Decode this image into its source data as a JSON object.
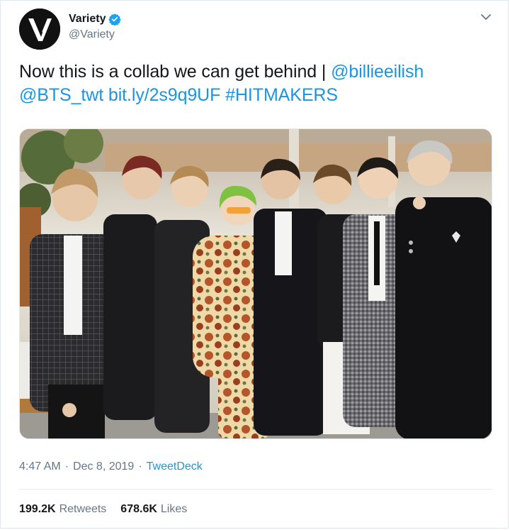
{
  "author": {
    "display_name": "Variety",
    "handle": "@Variety",
    "verified": true,
    "logo_letter": "V"
  },
  "tweet": {
    "text_prefix": "Now this is a collab we can get behind | ",
    "mention_1": "@billieeilish",
    "mention_2": "@BTS_twt",
    "link": "bit.ly/2s9q9UF",
    "hashtag": "#HITMAKERS"
  },
  "meta": {
    "time": "4:47 AM",
    "separator": "·",
    "date": "Dec 8, 2019",
    "source": "TweetDeck"
  },
  "stats": {
    "retweets_count": "199.2K",
    "retweets_label": "Retweets",
    "likes_count": "678.6K",
    "likes_label": "Likes"
  },
  "colors": {
    "link": "#1b95e0",
    "verified": "#1da1f2",
    "secondary_text": "#657786"
  }
}
